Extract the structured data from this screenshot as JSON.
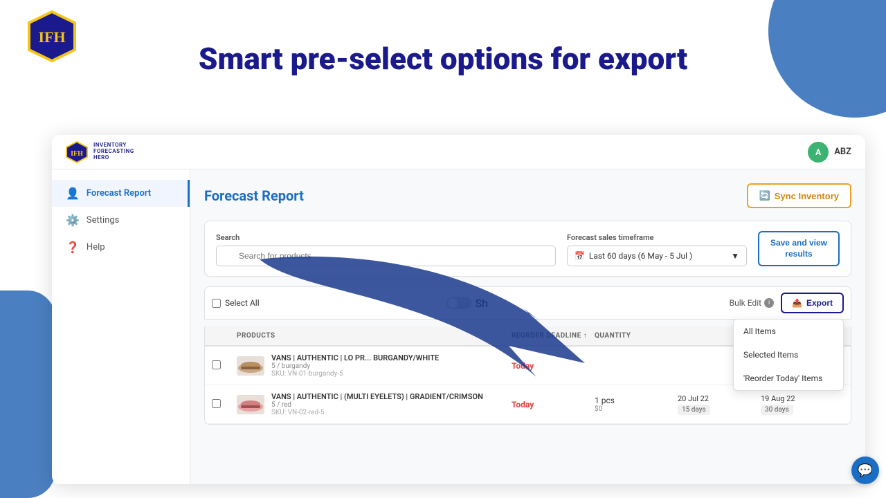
{
  "banner": {
    "title": "Smart pre-select options for export",
    "logo_text": "IFH"
  },
  "app": {
    "logo": {
      "lines": [
        "INVENTORY",
        "FORECASTING",
        "HERO"
      ],
      "abbr": "IFH"
    },
    "user": {
      "initials": "A",
      "name": "ABZ"
    }
  },
  "sidebar": {
    "items": [
      {
        "label": "Forecast Report",
        "icon": "📋",
        "active": true
      },
      {
        "label": "Settings",
        "icon": "⚙️",
        "active": false
      },
      {
        "label": "Help",
        "icon": "❓",
        "active": false
      }
    ]
  },
  "main": {
    "title": "Forecast Report",
    "sync_btn": "Sync Inventory",
    "search": {
      "label": "Search",
      "placeholder": "Search for products"
    },
    "timeframe": {
      "label": "Forecast sales timeframe",
      "value": "Last 60 days (6 May - 5 Jul )"
    },
    "save_btn_line1": "Save and view",
    "save_btn_line2": "results",
    "save_btn": "Save and view results",
    "select_all": "Select All",
    "show_label": "Sh",
    "bulk_edit": "Bulk Edit",
    "export_btn": "Export",
    "columns": [
      "PRODUCTS",
      "",
      "REORDER DEADLINE ↑",
      "QUANTITY",
      "",
      ""
    ],
    "products": [
      {
        "name": "VANS | AUTHENTIC | LO PR... BURGANDY/WHITE",
        "variant": "5 / burgandy",
        "sku": "SKU: VN-01-burgandy-5",
        "reorder": "Today",
        "qty": "",
        "deadline": "",
        "days": ""
      },
      {
        "name": "VANS | AUTHENTIC | (MULTI EYELETS) | GRADIENT/CRIMSON",
        "variant": "5 / red",
        "sku": "SKU: VN-02-red-5",
        "reorder": "Today",
        "qty": "1 pcs",
        "deadline": "20 Jul 22",
        "days": "15  days",
        "order_date": "19 Aug 22",
        "order_days": "30  days"
      }
    ],
    "export_dropdown": {
      "items": [
        {
          "label": "All Items",
          "active": false
        },
        {
          "label": "Selected Items",
          "active": false
        },
        {
          "label": "'Reorder Today' Items",
          "active": false
        }
      ]
    }
  }
}
